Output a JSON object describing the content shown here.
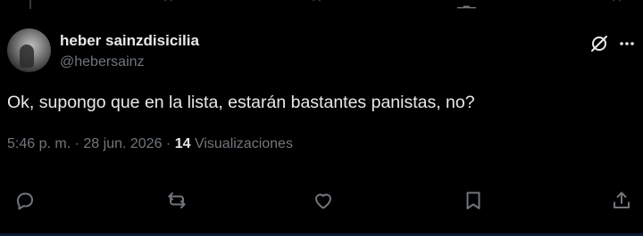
{
  "author": {
    "name": "heber sainzdisicilia",
    "handle": "@hebersainz"
  },
  "tweet": {
    "text": "Ok, supongo que en la lista, estarán bastantes panistas, no?",
    "time": "5:46 p. m.",
    "date": "28 jun. 2026",
    "separator": "·",
    "views_count": "14",
    "views_label": "Visualizaciones"
  },
  "icons": {
    "grok": "grok-icon",
    "more": "more-icon",
    "reply": "reply-icon",
    "retweet": "retweet-icon",
    "like": "like-icon",
    "bookmark": "bookmark-icon",
    "share": "share-icon"
  },
  "colors": {
    "background": "#000000",
    "primary_text": "#e7e9ea",
    "secondary_text": "#71767b"
  }
}
